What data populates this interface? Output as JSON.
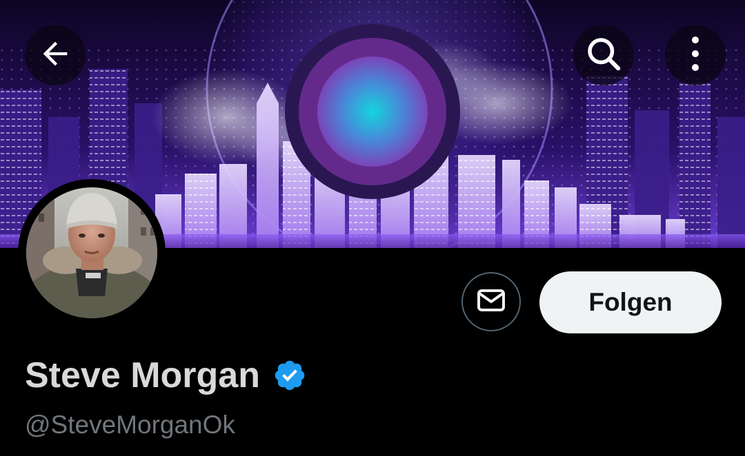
{
  "header": {
    "back_icon": "arrow-left-icon",
    "search_icon": "search-icon",
    "more_icon": "more-vertical-icon"
  },
  "banner": {
    "description_icon": "city-globe-illustration"
  },
  "profile": {
    "display_name": "Steve Morgan",
    "handle": "@SteveMorganOk",
    "verified": true,
    "verified_color": "#1d9bf0"
  },
  "actions": {
    "message_icon": "mail-icon",
    "follow_label": "Folgen"
  },
  "colors": {
    "background": "#000000",
    "follow_button_bg": "#eff3f4",
    "follow_button_text": "#0f1419",
    "handle_text": "#71767b"
  }
}
